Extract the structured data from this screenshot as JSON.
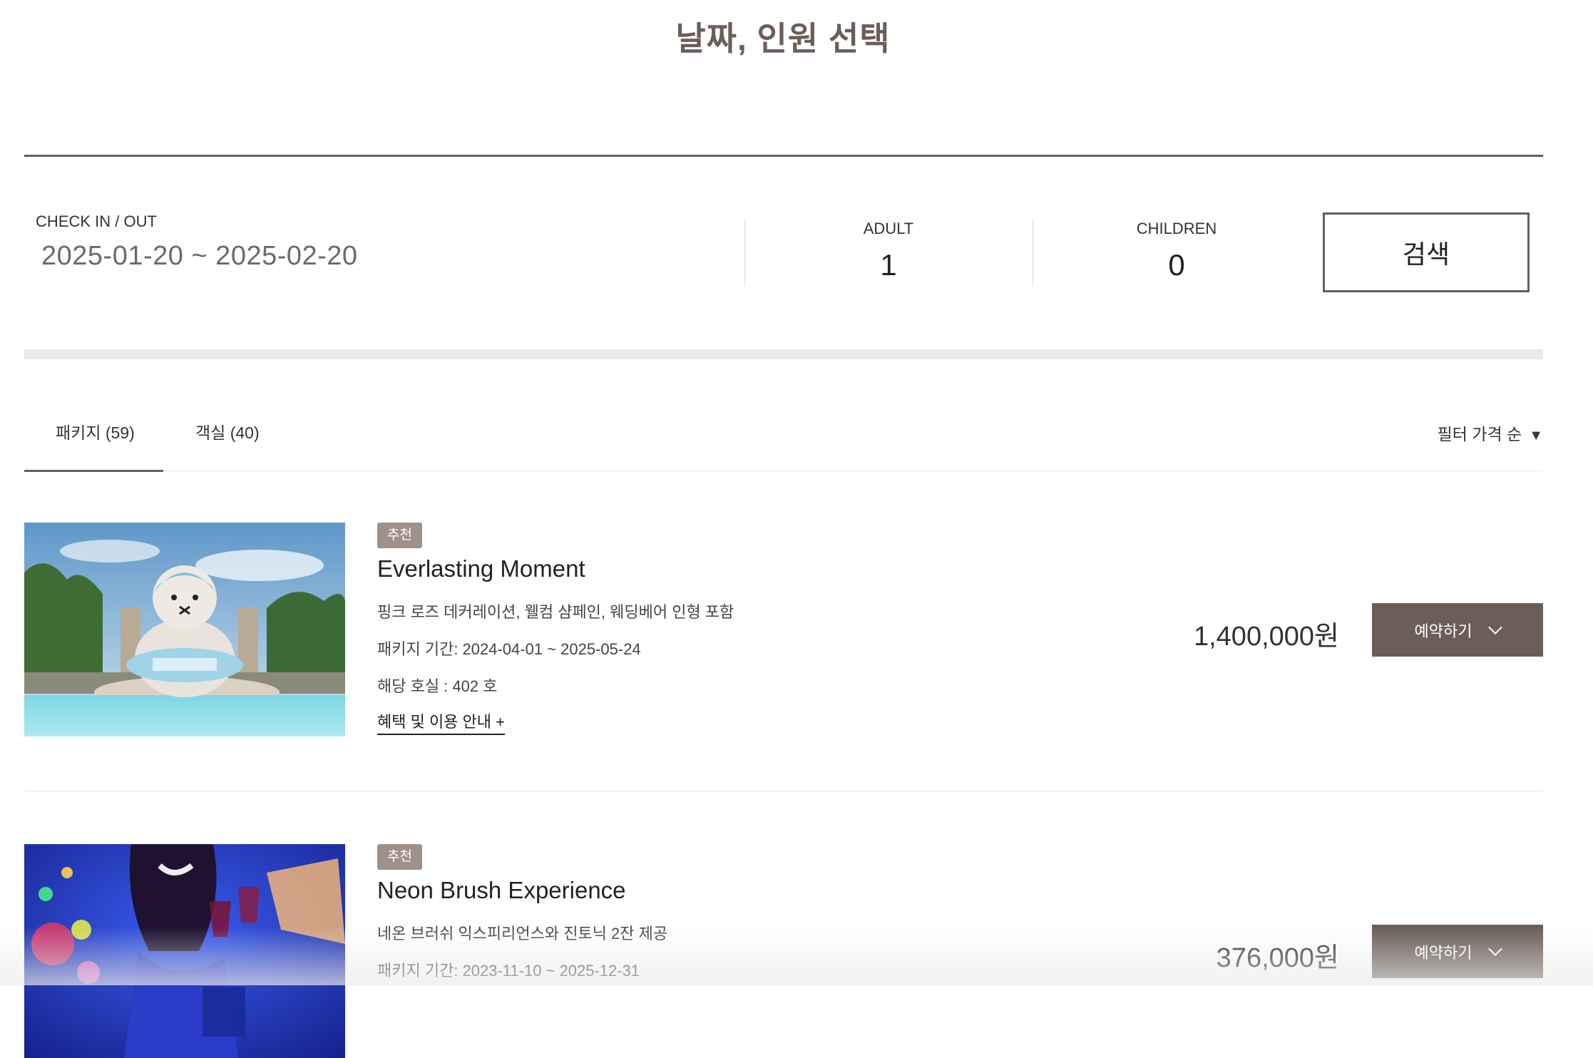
{
  "page": {
    "title": "날짜, 인원 선택"
  },
  "search": {
    "checkin_label": "CHECK IN / OUT",
    "date_range": "2025-01-20 ~ 2025-02-20",
    "adult_label": "ADULT",
    "adult_count": "1",
    "children_label": "CHILDREN",
    "children_count": "0",
    "search_label": "검색"
  },
  "tabs": [
    {
      "label": "패키지 (59)",
      "active": true
    },
    {
      "label": "객실 (40)",
      "active": false
    }
  ],
  "filter": {
    "label": "필터 가격 순",
    "caret": "▼"
  },
  "packages": [
    {
      "badge": "추천",
      "title": "Everlasting Moment",
      "description": "핑크 로즈 데커레이션, 웰컴 샴페인, 웨딩베어 인형 포함",
      "period": "패키지 기간: 2024-04-01 ~ 2025-05-24",
      "rooms": "해당 호실 : 402 호",
      "benefit_link": "혜택 및 이용 안내 +",
      "price": "1,400,000원",
      "reserve_label": "예약하기"
    },
    {
      "badge": "추천",
      "title": "Neon Brush Experience",
      "description": "네온 브러쉬 익스피리언스와 진토닉 2잔 제공",
      "period": "패키지 기간: 2023-11-10 ~ 2025-12-31",
      "price": "376,000원",
      "reserve_label": "예약하기"
    }
  ],
  "colors": {
    "accent": "#6b5e58",
    "badge": "#a09089",
    "band": "#eaeaea"
  }
}
